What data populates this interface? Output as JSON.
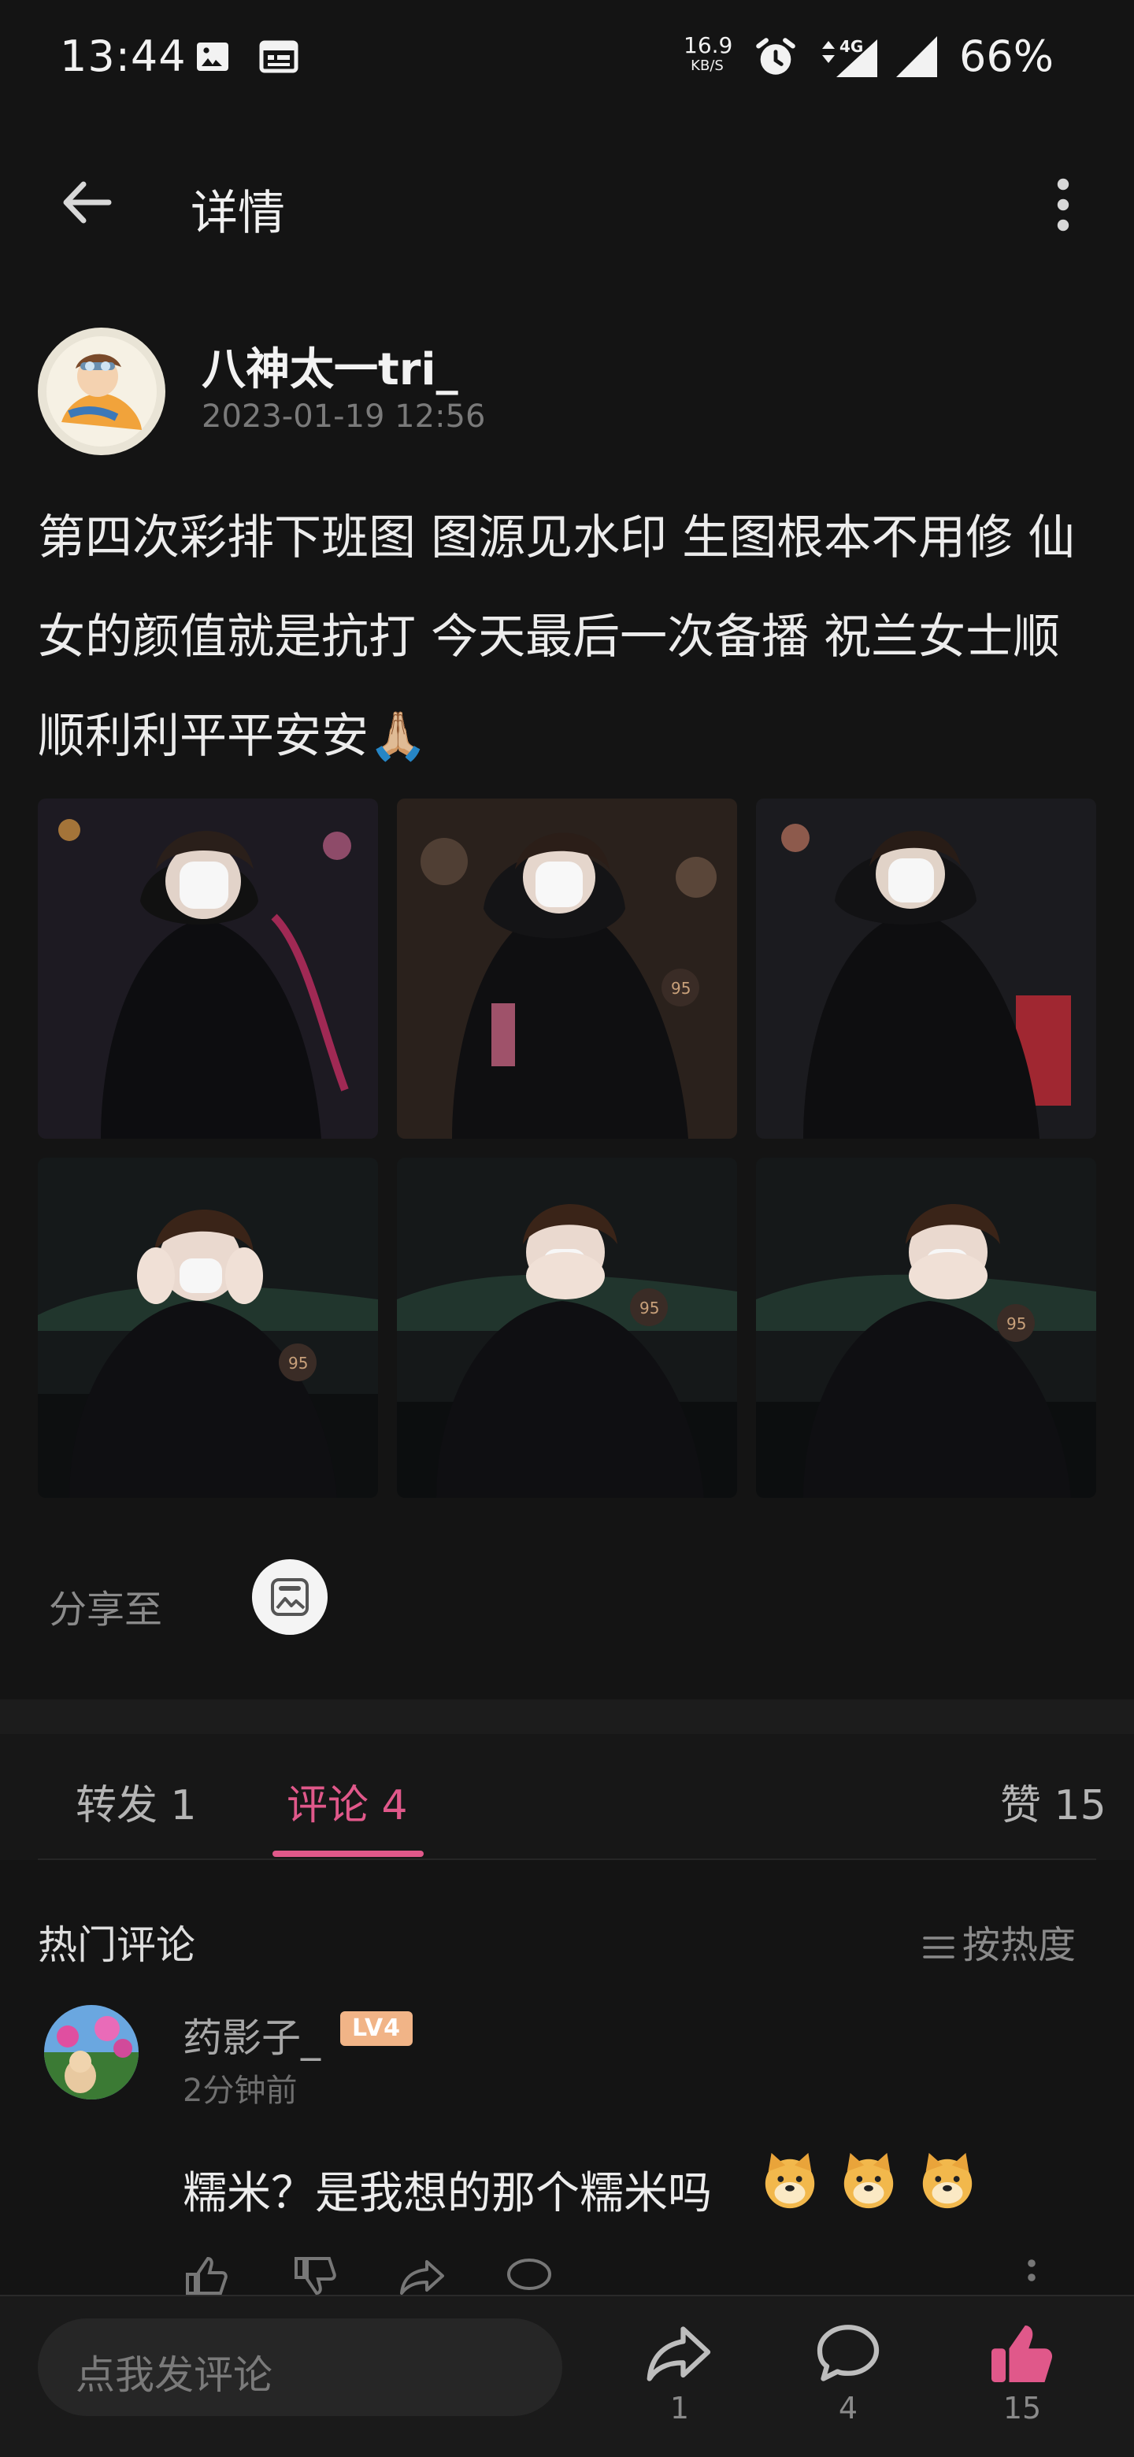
{
  "status_bar": {
    "time": "13:44",
    "net_speed_value": "16.9",
    "net_speed_unit": "KB/S",
    "network": "4G",
    "battery": "66%"
  },
  "app_bar": {
    "title": "详情"
  },
  "post": {
    "author": "八神太一tri_",
    "time": "2023-01-19 12:56",
    "text": "第四次彩排下班图 图源见水印 生图根本不用修 仙女的颜值就是抗打 今天最后一次备播 祝兰女士顺顺利利平平安安🙏🏼",
    "photo_count": 6
  },
  "share": {
    "label": "分享至"
  },
  "tabs": {
    "repost": "转发 1",
    "comment": "评论 4",
    "like": "赞 15"
  },
  "comments": {
    "section_title": "热门评论",
    "sort_label": "按热度",
    "items": [
      {
        "name": "药影子_",
        "level": "LV4",
        "time": "2分钟前",
        "text": "糯米？是我想的那个糯米吗"
      }
    ]
  },
  "bottom_bar": {
    "input_placeholder": "点我发评论",
    "repost_count": "1",
    "comment_count": "4",
    "like_count": "15"
  },
  "colors": {
    "accent": "#e0588a",
    "background": "#141414"
  }
}
